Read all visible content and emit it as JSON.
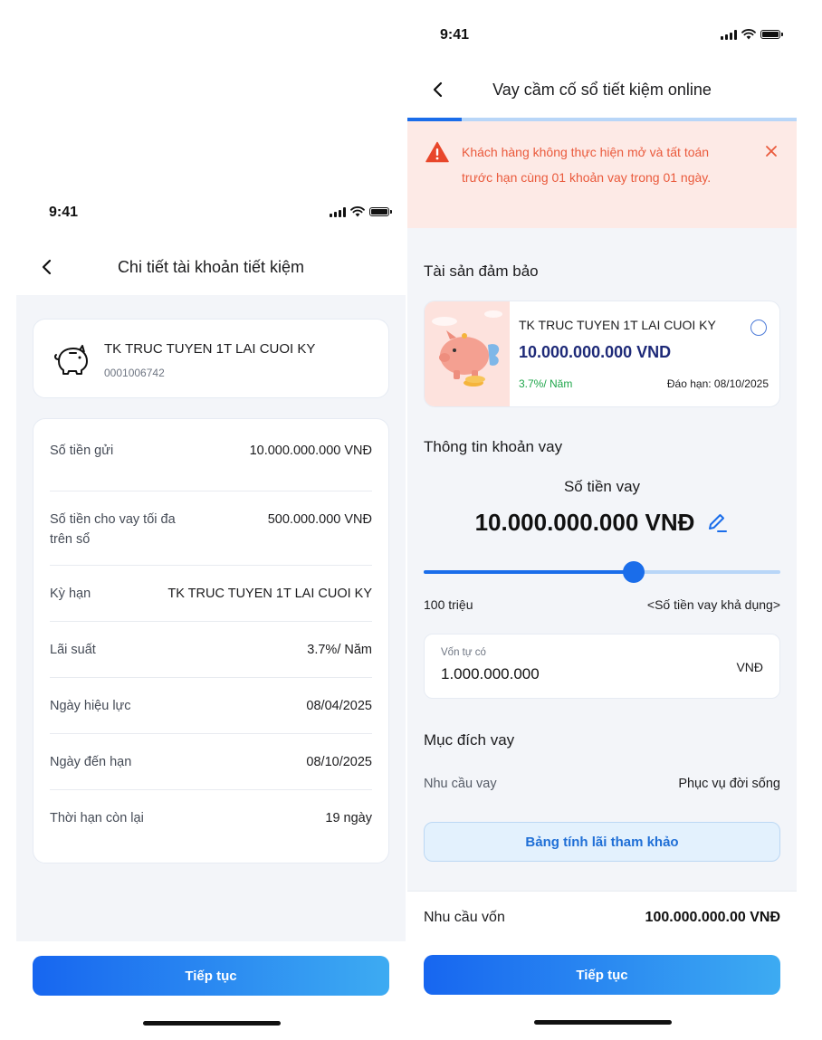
{
  "left_screen": {
    "status": {
      "time": "9:41"
    },
    "nav": {
      "title": "Chi tiết tài khoản tiết kiệm"
    },
    "account": {
      "name": "TK TRUC TUYEN 1T LAI CUOI KY",
      "number": "0001006742"
    },
    "details": [
      {
        "label": "Số tiền gửi",
        "value": "10.000.000.000 VNĐ"
      },
      {
        "label": "Số tiền cho vay tối đa trên sổ",
        "value": "500.000.000 VNĐ"
      },
      {
        "label": "Kỳ hạn",
        "value": "TK TRUC TUYEN 1T LAI CUOI KY"
      },
      {
        "label": "Lãi suất",
        "value": "3.7%/ Năm"
      },
      {
        "label": "Ngày hiệu lực",
        "value": "08/04/2025"
      },
      {
        "label": "Ngày đến hạn",
        "value": "08/10/2025"
      },
      {
        "label": "Thời hạn còn lại",
        "value": "19 ngày"
      }
    ],
    "continue_label": "Tiếp tục"
  },
  "right_screen": {
    "status": {
      "time": "9:41"
    },
    "nav": {
      "title": "Vay cầm cố sổ tiết kiệm online"
    },
    "progress": {
      "fraction": 0.14
    },
    "alert": {
      "message": "Khách hàng không thực hiện mở và tất toán trước hạn cùng 01 khoản vay trong 01 ngày."
    },
    "collateral": {
      "section_title": "Tài sản đảm bảo",
      "account_name": "TK TRUC TUYEN 1T LAI CUOI KY",
      "amount": "10.000.000.000 VND",
      "rate": "3.7%/ Năm",
      "maturity": "Đáo hạn: 08/10/2025"
    },
    "loan_info": {
      "section_title": "Thông tin khoản vay",
      "amount_label": "Số tiền vay",
      "amount": "10.000.000.000 VNĐ",
      "slider": {
        "min_label": "100 triệu",
        "max_label": "<Số tiền vay khả dụng>",
        "fraction": 0.59
      },
      "own_capital": {
        "label": "Vốn tự có",
        "value": "1.000.000.000",
        "unit": "VNĐ"
      }
    },
    "purpose": {
      "section_title": "Mục đích vay",
      "label": "Nhu cầu vay",
      "value": "Phục vụ đời sống"
    },
    "interest_table_label": "Bảng tính lãi tham khảo",
    "summary": {
      "label": "Nhu cầu vốn",
      "value": "100.000.000.00 VNĐ"
    },
    "continue_label": "Tiếp tục"
  },
  "colors": {
    "primary": "#1a6dea",
    "alert_bg": "#fdeae6",
    "alert_text": "#ea5a3c",
    "rate_green": "#1ea64a",
    "amount_navy": "#1e2a78"
  }
}
